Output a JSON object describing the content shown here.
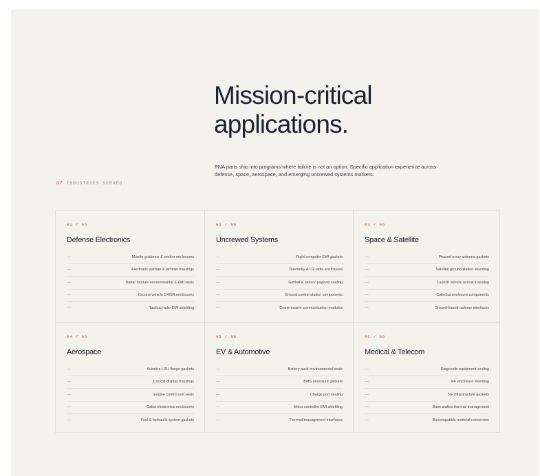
{
  "section": {
    "eyebrow_number": "07",
    "eyebrow_label": "INDUSTRIES SERVED",
    "headline_line1": "Mission-critical",
    "headline_line2": "applications.",
    "intro": "PNA parts ship into programs where failure is not an option. Specific application experience across defense, space, aerospace, and emerging uncrewed systems markets."
  },
  "cards": [
    {
      "number": "01 / 06",
      "title": "Defense Electronics",
      "items": [
        "Missile guidance & seeker enclosures",
        "Electronic warfare & jammer housings",
        "Radar module environmental & EMI seals",
        "Ground vehicle C4ISR enclosures",
        "Tactical radio EMI shielding"
      ]
    },
    {
      "number": "02 / 06",
      "title": "Uncrewed Systems",
      "items": [
        "Flight computer EMI gaskets",
        "Telemetry & C2 radio enclosures",
        "Gimbal & sensor payload sealing",
        "Ground control station components",
        "Drone swarm communication modules"
      ]
    },
    {
      "number": "03 / 06",
      "title": "Space & Satellite",
      "items": [
        "Phased-array antenna gaskets",
        "Satellite ground station shielding",
        "Launch vehicle avionics sealing",
        "CubeSat enclosure components",
        "Ground-based radome interfaces"
      ]
    },
    {
      "number": "04 / 06",
      "title": "Aerospace",
      "items": [
        "Avionics LRU flange gaskets",
        "Cockpit display housings",
        "Engine control unit seals",
        "Cabin electronics enclosures",
        "Fuel & hydraulic system gaskets"
      ]
    },
    {
      "number": "05 / 06",
      "title": "EV & Automotive",
      "items": [
        "Battery pack environmental seals",
        "BMS enclosure gaskets",
        "Charge port sealing",
        "Motor controller EMI shielding",
        "Thermal management interfaces"
      ]
    },
    {
      "number": "06 / 06",
      "title": "Medical & Telecom",
      "items": [
        "Diagnostic equipment sealing",
        "RF enclosure shielding",
        "5G infrastructure gaskets",
        "Base station thermal management",
        "Biocompatible material conversion"
      ]
    }
  ],
  "list_marker": "—",
  "colors": {
    "background": "#f3f2ec",
    "headline": "#1b2233",
    "accent": "#c0392b",
    "divider": "#e0ded4"
  }
}
